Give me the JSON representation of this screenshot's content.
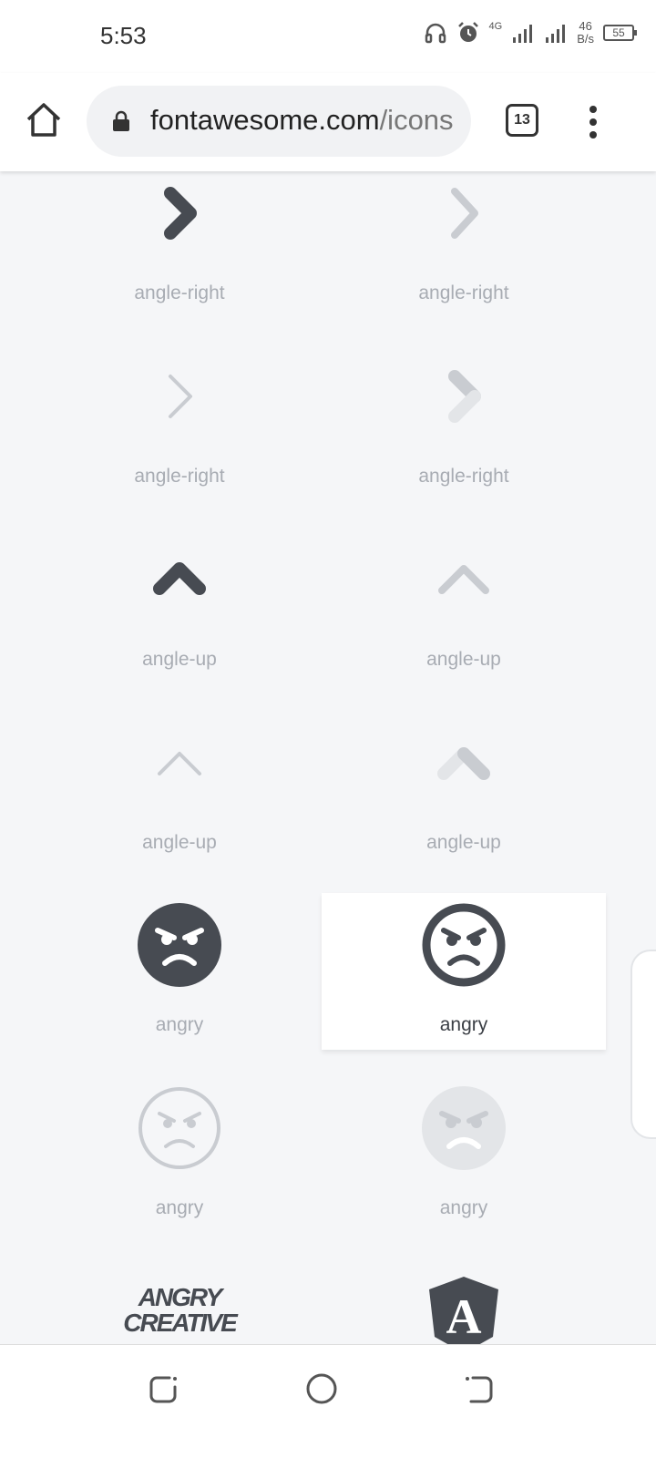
{
  "status_bar": {
    "time": "5:53",
    "net_type": "4G",
    "net_speed_value": "46",
    "net_speed_unit": "B/s",
    "battery": "55"
  },
  "browser": {
    "url_domain": "fontawesome.com",
    "url_path": "/icons",
    "tab_count": "13"
  },
  "icons": [
    {
      "label": "angle-right",
      "style": "solid",
      "glyph": "angle-right-icon"
    },
    {
      "label": "angle-right",
      "style": "regular",
      "glyph": "angle-right-icon"
    },
    {
      "label": "angle-right",
      "style": "light",
      "glyph": "angle-right-icon"
    },
    {
      "label": "angle-right",
      "style": "duotone",
      "glyph": "angle-right-icon"
    },
    {
      "label": "angle-up",
      "style": "solid",
      "glyph": "angle-up-icon"
    },
    {
      "label": "angle-up",
      "style": "regular",
      "glyph": "angle-up-icon"
    },
    {
      "label": "angle-up",
      "style": "light",
      "glyph": "angle-up-icon"
    },
    {
      "label": "angle-up",
      "style": "duotone",
      "glyph": "angle-up-icon"
    },
    {
      "label": "angry",
      "style": "solid",
      "glyph": "angry-face-icon"
    },
    {
      "label": "angry",
      "style": "regular",
      "glyph": "angry-face-icon",
      "selected": true
    },
    {
      "label": "angry",
      "style": "light",
      "glyph": "angry-face-icon"
    },
    {
      "label": "angry",
      "style": "duotone",
      "glyph": "angry-face-icon"
    },
    {
      "label": "",
      "style": "brand",
      "glyph": "angrycreative-logo-icon",
      "logo_text": [
        "ANGRY",
        "CREATIVE"
      ]
    },
    {
      "label": "",
      "style": "brand",
      "glyph": "angular-logo-icon",
      "logo_text": [
        "A"
      ]
    }
  ],
  "colors": {
    "icon_dark": "#474b52",
    "icon_light": "#c9ccd1",
    "icon_lighter": "#e3e5e8",
    "label": "#a8acb3",
    "background": "#f5f6f8"
  }
}
